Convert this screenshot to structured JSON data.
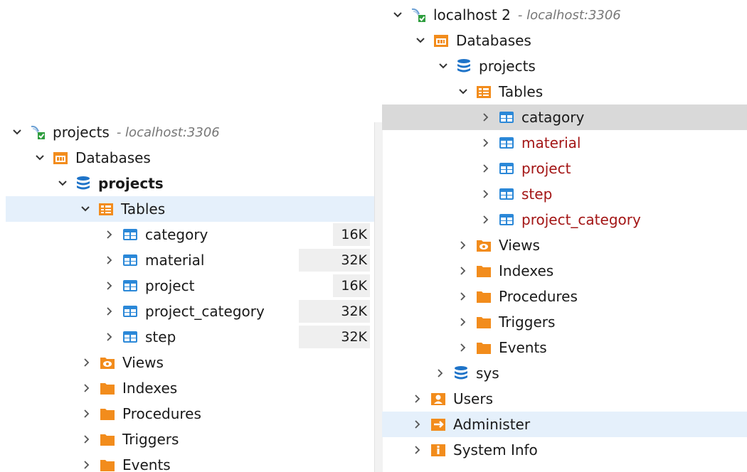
{
  "left": {
    "host_label": "projects",
    "host_address": "- localhost:3306",
    "databases_label": "Databases",
    "db_name": "projects",
    "tables_label": "Tables",
    "tables": [
      {
        "name": "category",
        "size": "16K"
      },
      {
        "name": "material",
        "size": "32K"
      },
      {
        "name": "project",
        "size": "16K"
      },
      {
        "name": "project_category",
        "size": "32K"
      },
      {
        "name": "step",
        "size": "32K"
      }
    ],
    "folders": [
      "Views",
      "Indexes",
      "Procedures",
      "Triggers",
      "Events"
    ]
  },
  "right": {
    "host_label": "localhost 2",
    "host_address": "- localhost:3306",
    "databases_label": "Databases",
    "db_name": "projects",
    "tables_label": "Tables",
    "tables": [
      "catagory",
      "material",
      "project",
      "step",
      "project_category"
    ],
    "folders": [
      "Views",
      "Indexes",
      "Procedures",
      "Triggers",
      "Events"
    ],
    "sys_db": "sys",
    "bottom_items": [
      "Users",
      "Administer",
      "System Info"
    ]
  },
  "colors": {
    "selection": "#e5f0fb",
    "hover": "#d9d9d9",
    "error_text": "#a31515",
    "table_icon": "#2b88d8",
    "folder_icon": "#f28c1c"
  }
}
